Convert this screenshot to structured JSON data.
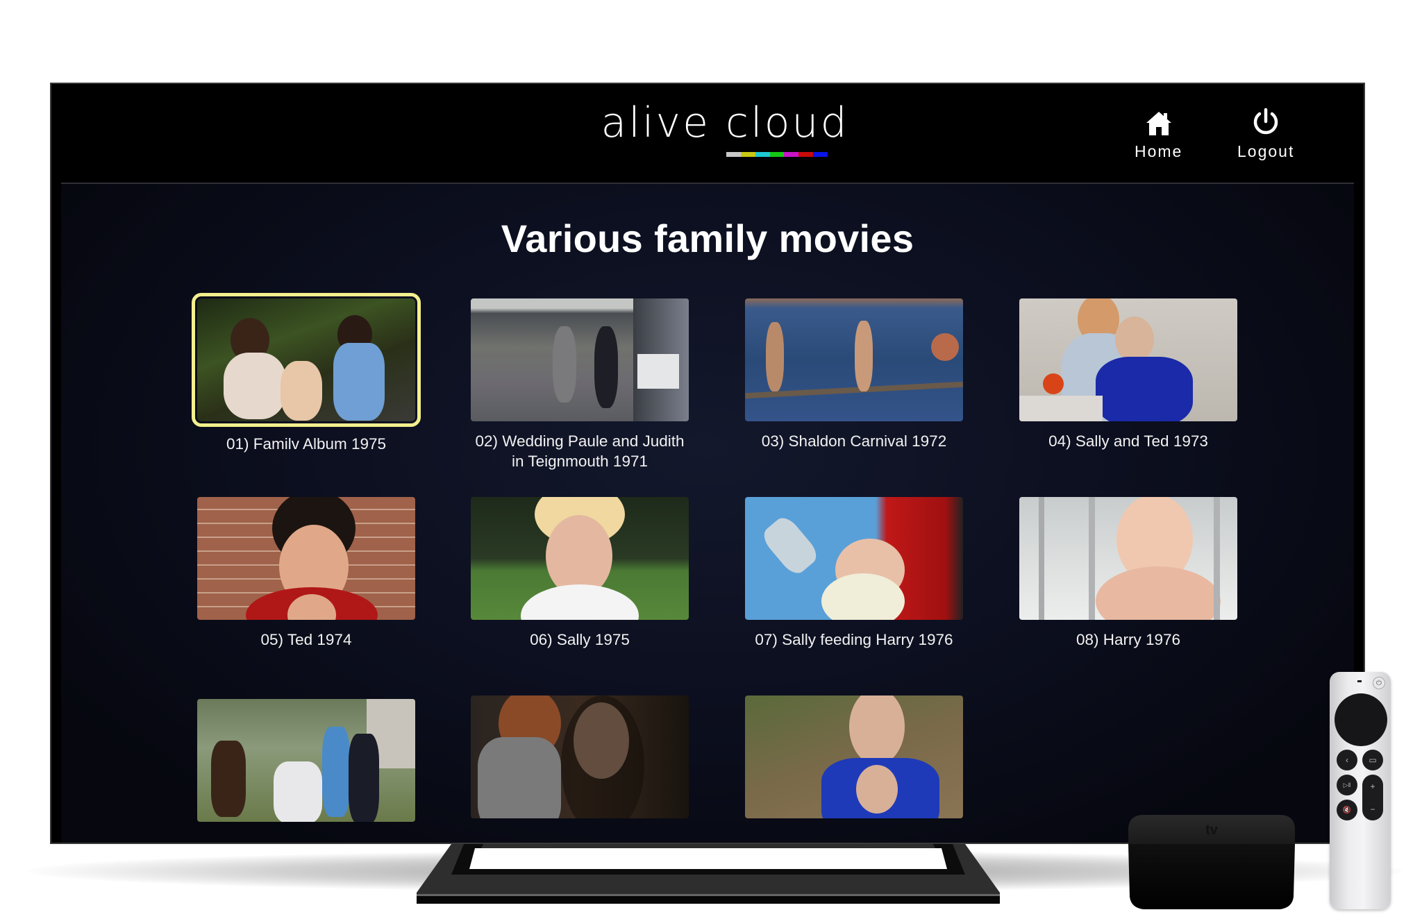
{
  "app": {
    "logo_text": "alive cloud",
    "logo_bar_colors": [
      "#c8c8c8",
      "#c8c814",
      "#1ec8d2",
      "#14c814",
      "#c814c8",
      "#c80a0a",
      "#0a14e6"
    ]
  },
  "nav": {
    "home": {
      "label": "Home",
      "icon": "home-icon"
    },
    "logout": {
      "label": "Logout",
      "icon": "power-icon"
    }
  },
  "page": {
    "title": "Various family movies"
  },
  "focus_color": "#f3f08d",
  "movies": [
    {
      "label": "01) Familv Album 1975",
      "focused": true
    },
    {
      "label": "02) Wedding Paule and Judith in Teignmouth 1971",
      "focused": false
    },
    {
      "label": "03) Shaldon Carnival 1972",
      "focused": false
    },
    {
      "label": "04) Sally and Ted 1973",
      "focused": false
    },
    {
      "label": "05) Ted 1974",
      "focused": false
    },
    {
      "label": "06) Sally 1975",
      "focused": false
    },
    {
      "label": "07) Sally feeding Harry 1976",
      "focused": false
    },
    {
      "label": "08) Harry 1976",
      "focused": false
    },
    {
      "label": "",
      "focused": false
    },
    {
      "label": "",
      "focused": false
    },
    {
      "label": "",
      "focused": false
    }
  ],
  "device": {
    "box_label": "tv"
  }
}
